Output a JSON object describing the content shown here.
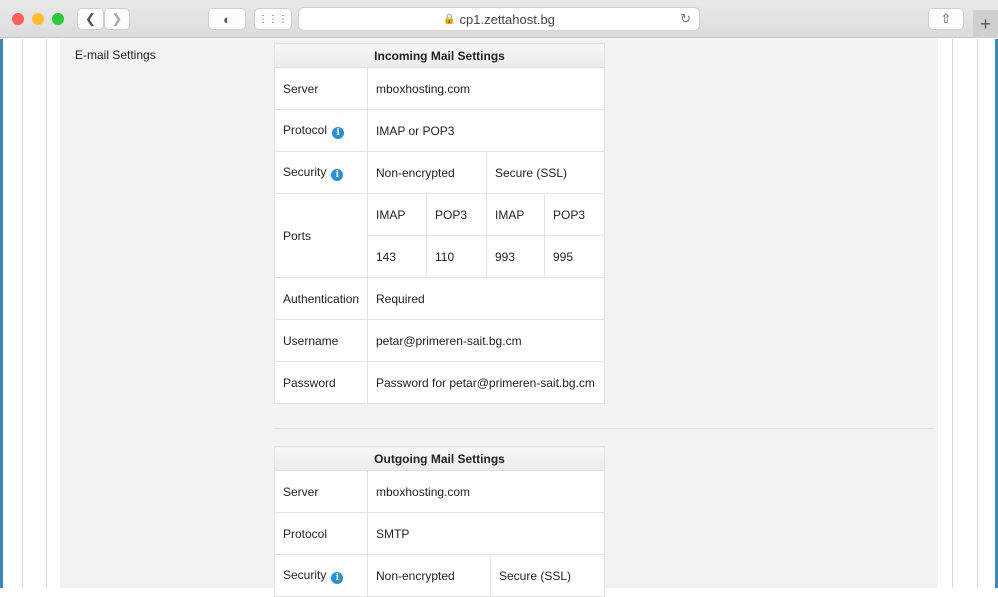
{
  "browser": {
    "url": "cp1.zettahost.bg",
    "back_icon": "chevron-left",
    "forward_icon": "chevron-right",
    "shield_icon": "shield",
    "grid_icon": "grid",
    "reload_icon": "reload",
    "share_icon": "share",
    "new_tab": "+",
    "colors": {
      "close": "#fe5f57",
      "minimize": "#febc2e",
      "zoom": "#28c840"
    }
  },
  "section_label": "E-mail Settings",
  "incoming": {
    "title": "Incoming Mail Settings",
    "server_label": "Server",
    "server": "mboxhosting.com",
    "protocol_label": "Protocol",
    "protocol": "IMAP or POP3",
    "security_label": "Security",
    "security_plain": "Non-encrypted",
    "security_ssl": "Secure (SSL)",
    "ports_label": "Ports",
    "ports_headers": [
      "IMAP",
      "POP3",
      "IMAP",
      "POP3"
    ],
    "ports_values": [
      "143",
      "110",
      "993",
      "995"
    ],
    "auth_label": "Authentication",
    "auth": "Required",
    "username_label": "Username",
    "username": "petar@primeren-sait.bg.cm",
    "password_label": "Password",
    "password": "Password for petar@primeren-sait.bg.cm"
  },
  "outgoing": {
    "title": "Outgoing Mail Settings",
    "server_label": "Server",
    "server": "mboxhosting.com",
    "protocol_label": "Protocol",
    "protocol": "SMTP",
    "security_label": "Security",
    "security_plain": "Non-encrypted",
    "security_ssl": "Secure (SSL)"
  },
  "info_glyph": "i"
}
